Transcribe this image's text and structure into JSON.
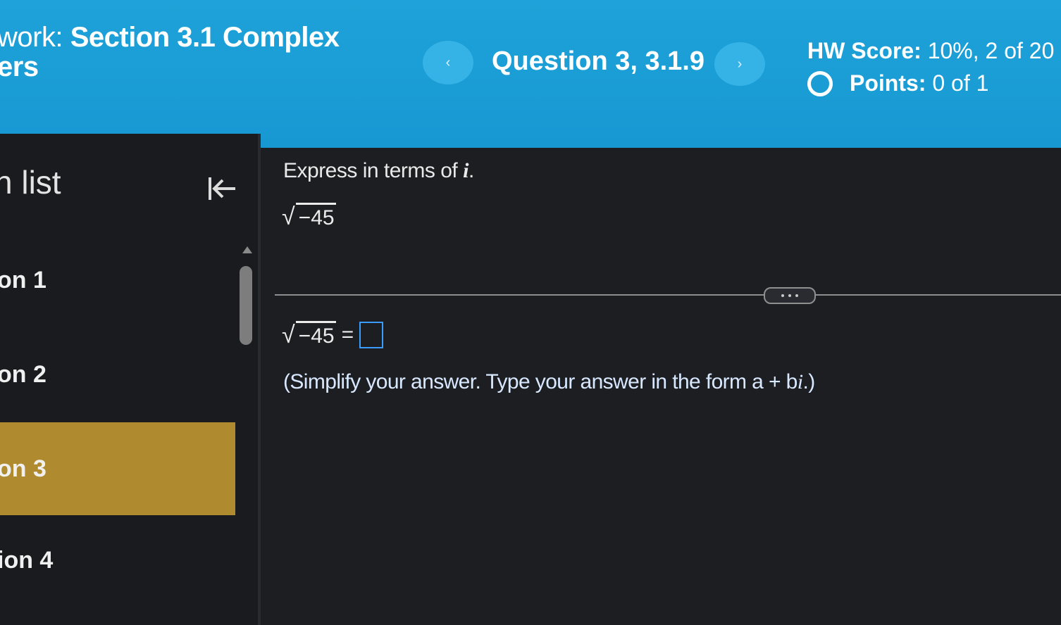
{
  "header": {
    "title_prefix": "work:",
    "title_main": "Section 3.1 Complex",
    "title_line2": "ers",
    "prev_label": "‹",
    "next_label": "›",
    "question_label": "Question 3, 3.1.9",
    "hw_score_label": "HW Score:",
    "hw_score_value": "10%, 2 of 20",
    "points_label": "Points:",
    "points_value": "0 of 1"
  },
  "sidebar": {
    "title": "n list",
    "items": [
      {
        "label": "on 1"
      },
      {
        "label": "on 2"
      },
      {
        "label": "on 3",
        "active": true
      },
      {
        "label": "ion 4"
      }
    ]
  },
  "main": {
    "prompt_text": "Express in terms of",
    "prompt_var": "i",
    "prompt_end": ".",
    "radicand": "−45",
    "equals": "=",
    "instruction_text": "(Simplify your answer. Type your answer in the form a + b",
    "instruction_var": "i",
    "instruction_end": ".)"
  },
  "colors": {
    "header_bg": "#1ea2d9",
    "active_item": "#b08a2e",
    "answer_box": "#3b9cff"
  }
}
